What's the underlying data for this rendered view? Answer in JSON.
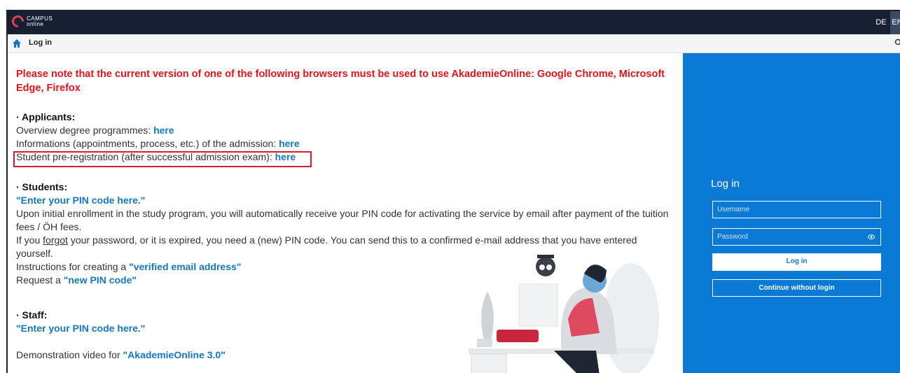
{
  "header": {
    "logo_line1": "CAMPUS",
    "logo_line2": "online",
    "lang_de": "DE",
    "lang_en": "EN"
  },
  "nav": {
    "title": "Log in"
  },
  "notice": {
    "text": "Please note that the current version of one of the following browsers must be used to use AkademieOnline: Google Chrome, Microsoft Edge, Firefox"
  },
  "applicants": {
    "heading": "· Applicants:",
    "line1_text": "Overview degree programmes: ",
    "line1_link": "here",
    "line2_text": "Informations (appointments, process, etc.) of the admission: ",
    "line2_link": "here",
    "line3_text": "Student pre-registration (after successful admission exam): ",
    "line3_link": "here"
  },
  "students": {
    "heading": "· Students:",
    "pin_link": "\"Enter your PIN code here.\"",
    "para1": "Upon initial enrollment in the study program, you will automatically receive your PIN code for activating the service by email after payment of the tuition fees / ÖH fees.",
    "para2_pre": "If you ",
    "para2_forgot": "forgot",
    "para2_post": " your password, or it is expired, you need a (new) PIN code. You can send this to a confirmed e-mail address that you have entered yourself.",
    "instr_text": "Instructions for creating a ",
    "instr_link": "\"verified email address\"",
    "req_text": "Request a ",
    "req_link": "\"new PIN code\""
  },
  "staff": {
    "heading": "· Staff:",
    "pin_link": "\"Enter your PIN code here.\""
  },
  "demo": {
    "text": "Demonstration video for ",
    "link": "\"AkademieOnline 3.0\""
  },
  "login": {
    "title": "Log in",
    "username_placeholder": "Username",
    "password_placeholder": "Password",
    "login_button": "Log in",
    "continue_button": "Continue without login"
  },
  "colors": {
    "topbar": "#172033",
    "login_panel": "#0b7ad6",
    "notice_red": "#e3141c",
    "link_blue": "#1577c2",
    "highlight_box": "#d3202a"
  }
}
